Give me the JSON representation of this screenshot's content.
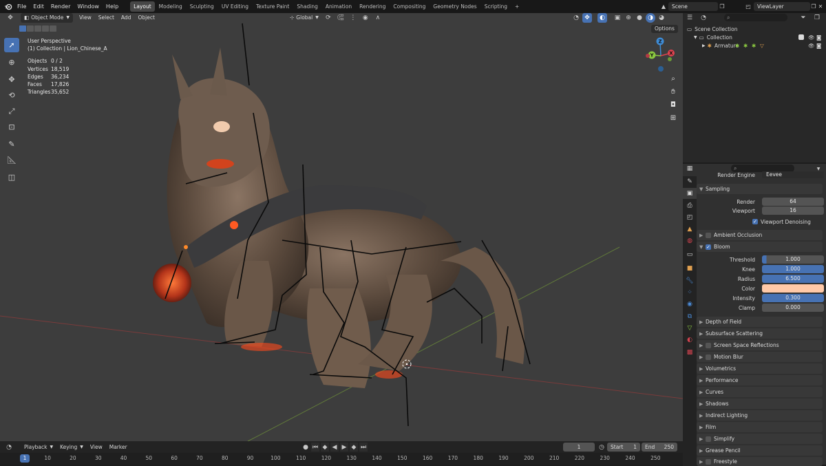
{
  "topbar": {
    "menus": [
      "File",
      "Edit",
      "Render",
      "Window",
      "Help"
    ],
    "workspaces": [
      "Layout",
      "Modeling",
      "Sculpting",
      "UV Editing",
      "Texture Paint",
      "Shading",
      "Animation",
      "Rendering",
      "Compositing",
      "Geometry Nodes",
      "Scripting"
    ],
    "active_workspace": "Layout",
    "add_tab": "+",
    "scene": "Scene",
    "view_layer": "ViewLayer"
  },
  "viewport": {
    "mode": "Object Mode",
    "menus": [
      "View",
      "Select",
      "Add",
      "Object"
    ],
    "orientation": "Global",
    "options_label": "Options",
    "view_name": "User Perspective",
    "collection_line": "(1) Collection | Lion_Chinese_A",
    "stats": [
      {
        "k": "Objects",
        "v": "0 / 2"
      },
      {
        "k": "Vertices",
        "v": "18,519"
      },
      {
        "k": "Edges",
        "v": "36,234"
      },
      {
        "k": "Faces",
        "v": "17,826"
      },
      {
        "k": "Triangles",
        "v": "35,652"
      }
    ],
    "gizmo": {
      "z": "Z",
      "y": "Y",
      "x": "X"
    }
  },
  "timeline": {
    "menus": [
      "Playback",
      "Keying",
      "View",
      "Marker"
    ],
    "current_frame": "1",
    "start_label": "Start",
    "start": "1",
    "end_label": "End",
    "end": "250",
    "playhead": "1",
    "ticks": [
      "10",
      "20",
      "30",
      "40",
      "50",
      "60",
      "70",
      "80",
      "90",
      "100",
      "110",
      "120",
      "130",
      "140",
      "150",
      "160",
      "170",
      "180",
      "190",
      "200",
      "210",
      "220",
      "230",
      "240",
      "250"
    ]
  },
  "outliner": {
    "items": [
      {
        "label": "Scene Collection"
      },
      {
        "label": "Collection"
      },
      {
        "label": "Armature"
      }
    ]
  },
  "properties": {
    "render_engine_label": "Render Engine",
    "render_engine": "Eevee",
    "sampling": {
      "title": "Sampling",
      "render_label": "Render",
      "render": "64",
      "viewport_label": "Viewport",
      "viewport": "16",
      "denoise_label": "Viewport Denoising"
    },
    "ambient_occlusion": "Ambient Occlusion",
    "bloom": {
      "title": "Bloom",
      "threshold_label": "Threshold",
      "threshold": "1.000",
      "knee_label": "Knee",
      "knee": "1.000",
      "radius_label": "Radius",
      "radius": "6.500",
      "color_label": "Color",
      "color": "#ffc9a8",
      "intensity_label": "Intensity",
      "intensity": "0.300",
      "clamp_label": "Clamp",
      "clamp": "0.000"
    },
    "sections": [
      "Depth of Field",
      "Subsurface Scattering",
      "Screen Space Reflections",
      "Motion Blur",
      "Volumetrics",
      "Performance",
      "Curves",
      "Shadows",
      "Indirect Lighting",
      "Film",
      "Simplify",
      "Grease Pencil",
      "Freestyle"
    ]
  },
  "colors": {
    "accent": "#4772b3",
    "active_tool": "#4772b3",
    "axis_x": "#e0434f",
    "axis_y": "#8ac840",
    "axis_z": "#3e8cd6"
  }
}
